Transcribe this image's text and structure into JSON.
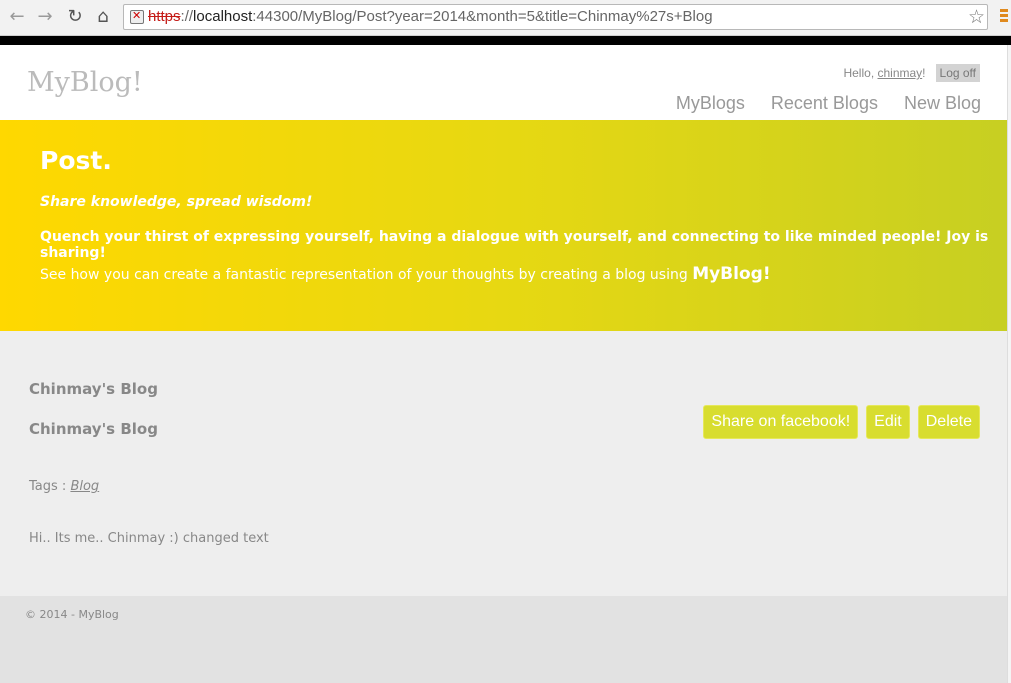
{
  "browser": {
    "url_scheme": "https",
    "url_sep": "://",
    "url_host": "localhost",
    "url_rest": ":44300/MyBlog/Post?year=2014&month=5&title=Chinmay%27s+Blog",
    "back_icon": "←",
    "forward_icon": "→",
    "reload_icon": "↻",
    "home_icon": "⌂",
    "star_icon": "☆"
  },
  "header": {
    "logo": "MyBlog!",
    "hello": "Hello, ",
    "username": "chinmay",
    "exclaim": "!",
    "logoff": "Log off",
    "menu": [
      "MyBlogs",
      "Recent Blogs",
      "New Blog"
    ]
  },
  "featured": {
    "title": "Post.",
    "tagline1": "Share knowledge, spread wisdom!",
    "tagline2": "Quench your thirst of expressing yourself, having a dialogue with yourself, and connecting to like minded people! Joy is sharing!",
    "tagline3": "See how you can create a fantastic representation of your thoughts by creating a blog using ",
    "brand": "MyBlog!"
  },
  "post": {
    "title": "Chinmay's Blog",
    "subtitle": "Chinmay's Blog",
    "tags_label": "Tags : ",
    "tag": "Blog",
    "body": "Hi.. Its me.. Chinmay :) changed text",
    "buttons": {
      "share": "Share on facebook!",
      "edit": "Edit",
      "delete": "Delete"
    }
  },
  "footer": {
    "copyright": "© 2014 - MyBlog"
  },
  "colors": {
    "accent": "#d8dd2f",
    "banner_start": "#ffd800",
    "banner_end": "#c7cf22"
  }
}
